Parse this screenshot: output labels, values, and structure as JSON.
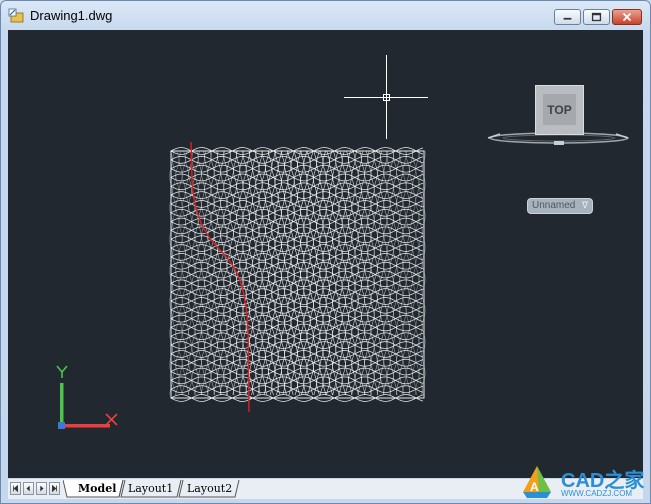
{
  "window": {
    "title": "Drawing1.dwg"
  },
  "viewcube": {
    "face_label": "TOP"
  },
  "ucs_menu": {
    "label": "Unnamed",
    "chevron": "∇"
  },
  "ucs_icon": {
    "x_label": "X",
    "y_label": "Y",
    "x_color": "#e84040",
    "y_color": "#4cc34c"
  },
  "layout_tabs": [
    {
      "label": "Model",
      "active": true
    },
    {
      "label": "Layout1",
      "active": false
    },
    {
      "label": "Layout2",
      "active": false
    }
  ],
  "nav_icons": [
    "first-tab-icon",
    "prev-tab-icon",
    "next-tab-icon",
    "last-tab-icon"
  ],
  "watermark": {
    "brand": "CAD之家",
    "url": "WWW.CADZJ.COM"
  },
  "colors": {
    "viewport_bg": "#212830",
    "geometry": "#ffffff",
    "path_curve": "#e02020"
  }
}
